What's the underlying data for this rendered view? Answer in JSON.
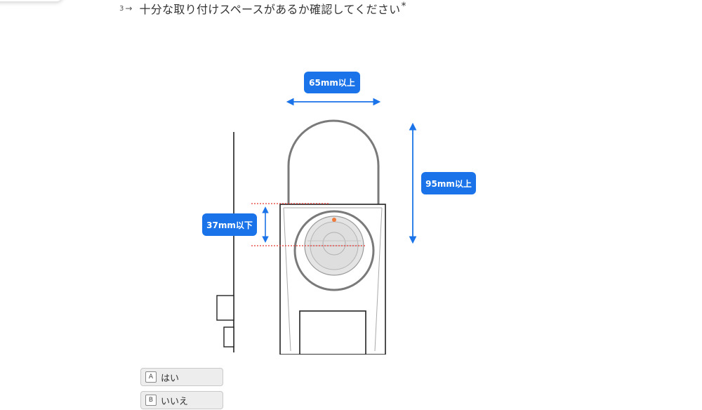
{
  "question": {
    "number": "3",
    "arrow": "→",
    "text": "十分な取り付けスペースがあるか確認してください",
    "required_mark": "*"
  },
  "illustration": {
    "label_width": "65mm以上",
    "label_height": "95mm以上",
    "label_offset": "37mm以下",
    "accent_color": "#1a73e8",
    "guide_color": "#e53935",
    "marker_color": "#f07a3a"
  },
  "choices": [
    {
      "key": "A",
      "label": "はい"
    },
    {
      "key": "B",
      "label": "いいえ"
    }
  ]
}
